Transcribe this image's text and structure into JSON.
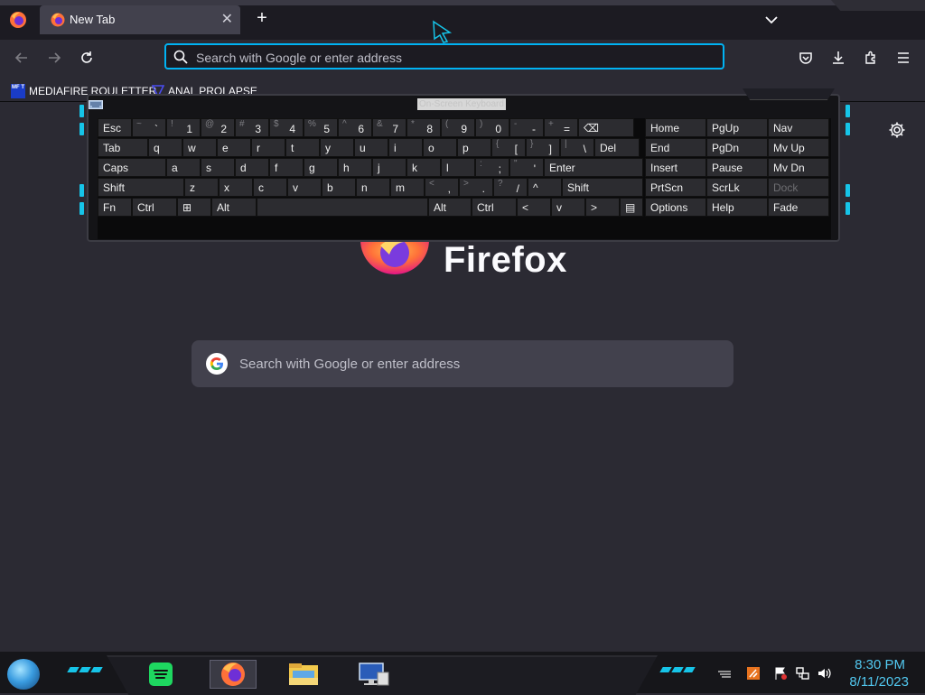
{
  "tab": {
    "title": "New Tab",
    "close_icon": "close-icon"
  },
  "urlbar": {
    "placeholder": "Search with Google or enter address"
  },
  "bookmarks": [
    {
      "icon_text": "MF T",
      "label": "MEDIAFIRE ROULETTER"
    },
    {
      "label": "ANAL PROLAPSE"
    }
  ],
  "content": {
    "wordmark": "Firefox",
    "search_placeholder": "Search with Google or enter address"
  },
  "osk": {
    "title": "On-Screen Keyboard",
    "keys": [
      {
        "label": "Esc"
      },
      {
        "shift": "~",
        "main": "`"
      },
      {
        "shift": "!",
        "main": "1"
      },
      {
        "shift": "@",
        "main": "2"
      },
      {
        "shift": "#",
        "main": "3"
      },
      {
        "shift": "$",
        "main": "4"
      },
      {
        "shift": "%",
        "main": "5"
      },
      {
        "shift": "^",
        "main": "6"
      },
      {
        "shift": "&",
        "main": "7"
      },
      {
        "shift": "*",
        "main": "8"
      },
      {
        "shift": "(",
        "main": "9"
      },
      {
        "shift": ")",
        "main": "0"
      },
      {
        "shift": "-",
        "main": "-"
      },
      {
        "shift": "+",
        "main": "="
      },
      {
        "label": "⌫"
      },
      {
        "label": "Tab"
      },
      {
        "label": "q"
      },
      {
        "label": "w"
      },
      {
        "label": "e"
      },
      {
        "label": "r"
      },
      {
        "label": "t"
      },
      {
        "label": "y"
      },
      {
        "label": "u"
      },
      {
        "label": "i"
      },
      {
        "label": "o"
      },
      {
        "label": "p"
      },
      {
        "shift": "{",
        "main": "["
      },
      {
        "shift": "}",
        "main": "]"
      },
      {
        "shift": "|",
        "main": "\\"
      },
      {
        "label": "Del"
      },
      {
        "label": "Caps"
      },
      {
        "label": "a"
      },
      {
        "label": "s"
      },
      {
        "label": "d"
      },
      {
        "label": "f"
      },
      {
        "label": "g"
      },
      {
        "label": "h"
      },
      {
        "label": "j"
      },
      {
        "label": "k"
      },
      {
        "label": "l"
      },
      {
        "shift": ":",
        "main": ";"
      },
      {
        "shift": "\"",
        "main": "'"
      },
      {
        "label": "Enter"
      },
      {
        "label": "Shift"
      },
      {
        "label": "z"
      },
      {
        "label": "x"
      },
      {
        "label": "c"
      },
      {
        "label": "v"
      },
      {
        "label": "b"
      },
      {
        "label": "n"
      },
      {
        "label": "m"
      },
      {
        "shift": "<",
        "main": ","
      },
      {
        "shift": ">",
        "main": "."
      },
      {
        "shift": "?",
        "main": "/"
      },
      {
        "label": "^"
      },
      {
        "label": "Shift"
      },
      {
        "label": "Fn"
      },
      {
        "label": "Ctrl"
      },
      {
        "label": "⊞"
      },
      {
        "label": "Alt"
      },
      {
        "label": ""
      },
      {
        "label": "Alt"
      },
      {
        "label": "Ctrl"
      },
      {
        "label": "<"
      },
      {
        "label": "v"
      },
      {
        "label": ">"
      },
      {
        "label": "▤"
      },
      {
        "label": "Home"
      },
      {
        "label": "PgUp"
      },
      {
        "label": "Nav"
      },
      {
        "label": "End"
      },
      {
        "label": "PgDn"
      },
      {
        "label": "Mv Up"
      },
      {
        "label": "Insert"
      },
      {
        "label": "Pause"
      },
      {
        "label": "Mv Dn"
      },
      {
        "label": "PrtScn"
      },
      {
        "label": "ScrLk"
      },
      {
        "label": "Dock",
        "dim": true
      },
      {
        "label": "Options"
      },
      {
        "label": "Help"
      },
      {
        "label": "Fade"
      }
    ]
  },
  "taskbar": {
    "apps": [
      "spotify-icon",
      "firefox-icon",
      "file-explorer-icon",
      "remote-desktop-icon"
    ],
    "clock": {
      "time": "8:30 PM",
      "date": "8/11/2023"
    }
  },
  "colors": {
    "accent": "#00b3f4",
    "led": "#16c4e8",
    "clock": "#52c8f0"
  }
}
